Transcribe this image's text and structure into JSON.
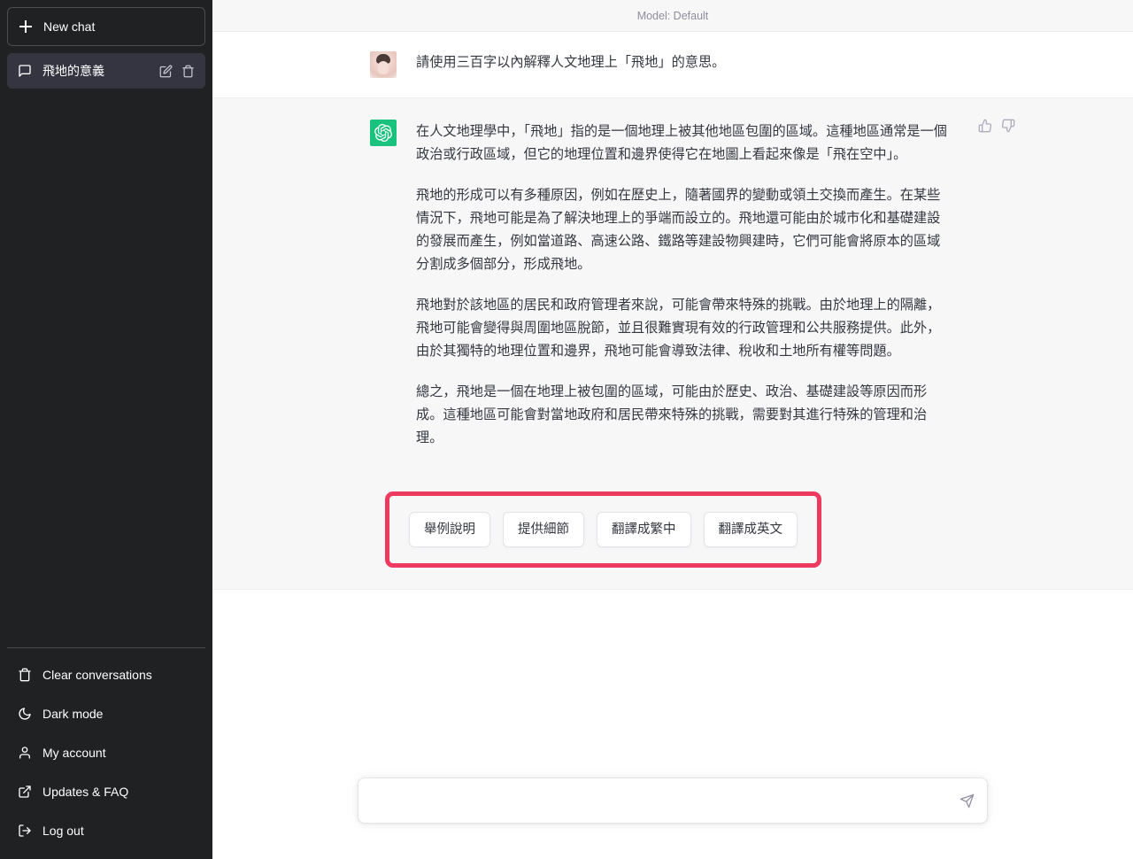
{
  "sidebar": {
    "new_chat_label": "New chat",
    "conversations": [
      {
        "title": "飛地的意義",
        "active": true
      }
    ],
    "bottom_items": [
      {
        "label": "Clear conversations",
        "icon": "trash-icon"
      },
      {
        "label": "Dark mode",
        "icon": "moon-icon"
      },
      {
        "label": "My account",
        "icon": "person-icon"
      },
      {
        "label": "Updates & FAQ",
        "icon": "external-link-icon"
      },
      {
        "label": "Log out",
        "icon": "logout-icon"
      }
    ]
  },
  "header": {
    "model_label": "Model: Default"
  },
  "conversation": {
    "user_message": "請使用三百字以內解釋人文地理上「飛地」的意思。",
    "assistant_paragraphs": [
      "在人文地理學中，「飛地」指的是一個地理上被其他地區包圍的區域。這種地區通常是一個政治或行政區域，但它的地理位置和邊界使得它在地圖上看起來像是「飛在空中」。",
      "飛地的形成可以有多種原因，例如在歷史上，隨著國界的變動或領土交換而產生。在某些情況下，飛地可能是為了解決地理上的爭端而設立的。飛地還可能由於城市化和基礎建設的發展而產生，例如當道路、高速公路、鐵路等建設物興建時，它們可能會將原本的區域分割成多個部分，形成飛地。",
      "飛地對於該地區的居民和政府管理者來說，可能會帶來特殊的挑戰。由於地理上的隔離，飛地可能會變得與周圍地區脫節，並且很難實現有效的行政管理和公共服務提供。此外，由於其獨特的地理位置和邊界，飛地可能會導致法律、稅收和土地所有權等問題。",
      "總之，飛地是一個在地理上被包圍的區域，可能由於歷史、政治、基礎建設等原因而形成。這種地區可能會對當地政府和居民帶來特殊的挑戰，需要對其進行特殊的管理和治理。"
    ],
    "feedback": {
      "thumbs_up": "thumb-up-icon",
      "thumbs_down": "thumb-down-icon"
    },
    "suggestions": [
      "舉例說明",
      "提供細節",
      "翻譯成繁中",
      "翻譯成英文"
    ]
  },
  "composer": {
    "value": "",
    "placeholder": "",
    "send_icon": "send-icon"
  },
  "colors": {
    "sidebar_bg": "#202123",
    "sidebar_active": "#343541",
    "assistant_row_bg": "#F7F7F8",
    "assistant_avatar": "#19C37D",
    "highlight": "#EE3A5F",
    "text": "#353740",
    "muted": "#8E8EA0"
  }
}
